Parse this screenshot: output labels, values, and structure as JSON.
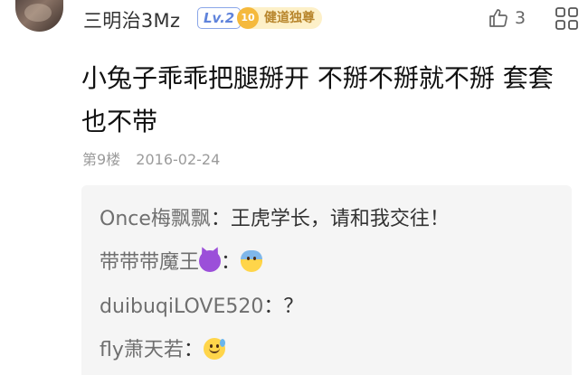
{
  "post": {
    "username": "三明治3Mz",
    "level": "Lv.2",
    "fan_badge": {
      "number": "10",
      "label": "健道独尊"
    },
    "like_count": "3",
    "content": "小兔子乖乖把腿掰开 不掰不掰就不掰 套套也不带",
    "floor": "第9楼",
    "date": "2016-02-24"
  },
  "replies": [
    {
      "name": "Once梅飘飘",
      "separator": "：",
      "text": "王虎学长，请和我交往！",
      "emoji": ""
    },
    {
      "name": "带带带魔王",
      "name_emoji": "smiling-devil-emoji",
      "separator": "：",
      "text": "",
      "emoji": "fearful-face-emoji"
    },
    {
      "name": "duibuqiLOVE520",
      "separator": "：",
      "text": "？",
      "emoji": ""
    },
    {
      "name": "fly萧天若",
      "separator": "：",
      "text": "",
      "emoji": "grinning-sweat-emoji"
    }
  ],
  "colors": {
    "level_blue": "#5f83db",
    "badge_gold": "#b8862d",
    "reply_bg": "#f5f5f5"
  }
}
